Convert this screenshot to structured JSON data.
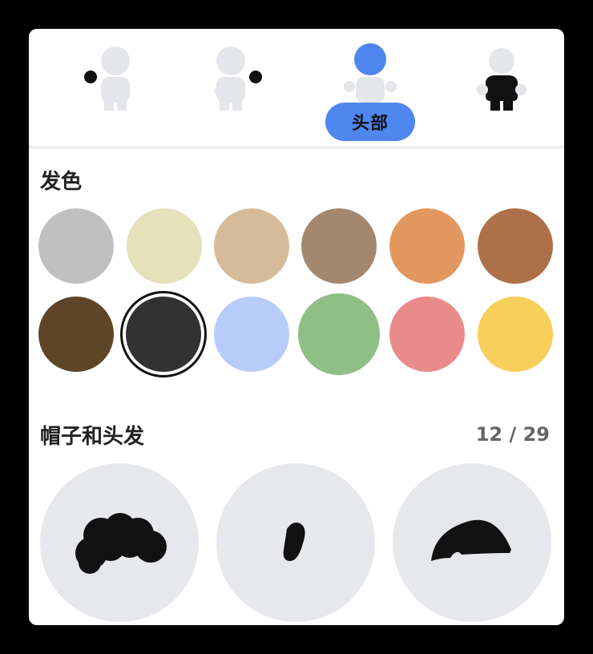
{
  "tabs": [
    {
      "name": "tab-body-left-hand",
      "icon": "figure-left-hand-icon"
    },
    {
      "name": "tab-body-right-hand",
      "icon": "figure-right-hand-icon"
    },
    {
      "name": "tab-head",
      "icon": "figure-head-icon",
      "label": "头部",
      "active": true
    },
    {
      "name": "tab-torso",
      "icon": "figure-torso-icon"
    }
  ],
  "hair_color": {
    "title": "发色",
    "swatches": [
      {
        "color": "#c0c0c0"
      },
      {
        "color": "#e6e0bb"
      },
      {
        "color": "#d6bb9b"
      },
      {
        "color": "#a3876f"
      },
      {
        "color": "#e2975f"
      },
      {
        "color": "#ae7048"
      },
      {
        "color": "#5e4528"
      },
      {
        "color": "#323232",
        "selected": true
      },
      {
        "color": "#b7ccfa"
      },
      {
        "color": "#8fbe86"
      },
      {
        "color": "#ea8b8b"
      },
      {
        "color": "#f8cf5b"
      }
    ]
  },
  "hats_and_hair": {
    "title": "帽子和头发",
    "counter": "12 / 29",
    "options": [
      {
        "icon": "curly-hair-icon"
      },
      {
        "icon": "small-tuft-hair-icon"
      },
      {
        "icon": "short-cap-hair-icon"
      }
    ]
  },
  "colors": {
    "accent": "#4f86f0",
    "inactive_figure": "#e4e6ea",
    "active_part": "#111111"
  }
}
